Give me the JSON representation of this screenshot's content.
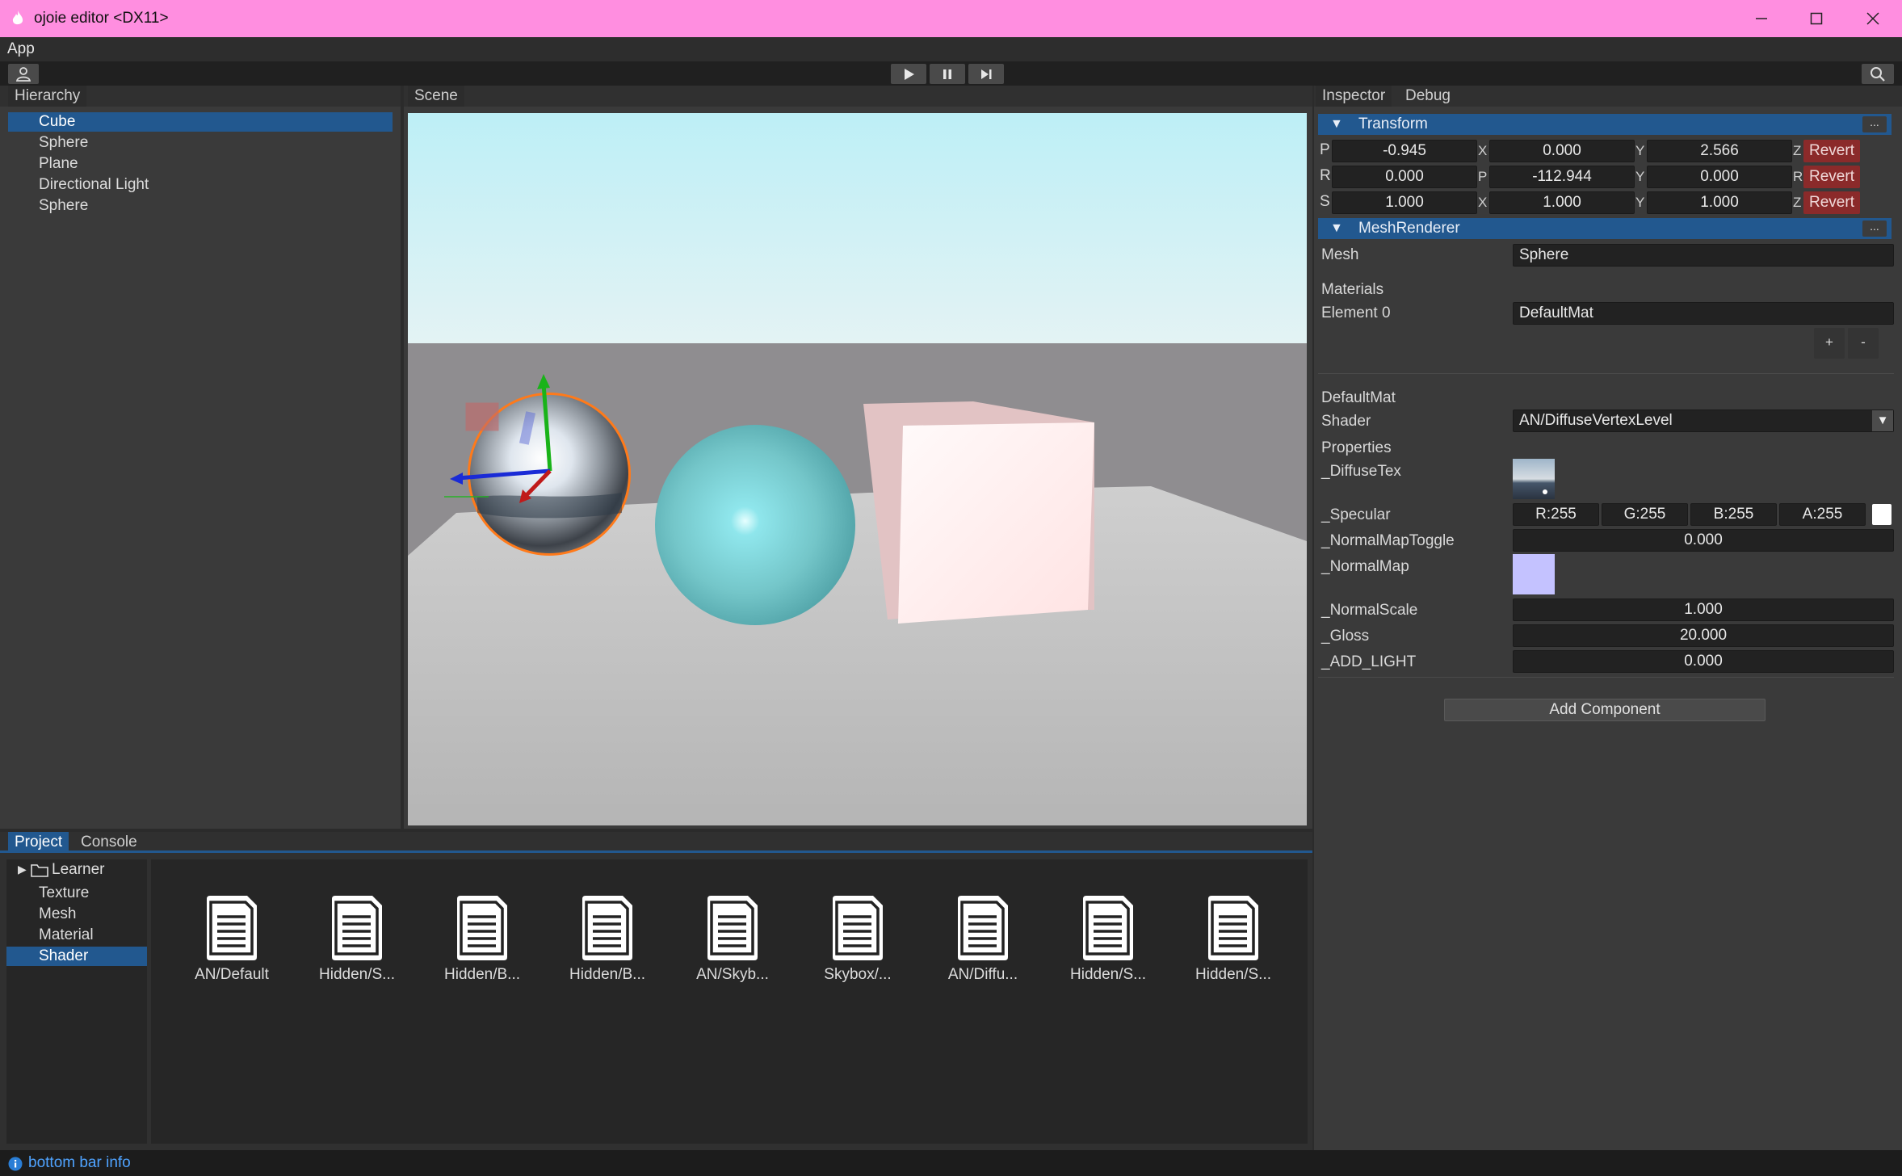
{
  "window": {
    "title": "ojoie editor <DX11>",
    "title_bar_color": "#ff8ee0",
    "accent_color": "#22588f",
    "revert_color": "#8b2a2a"
  },
  "menu": {
    "items": [
      "App"
    ]
  },
  "toolbar": {
    "user_icon": "user-icon",
    "play_icon": "play-icon",
    "pause_icon": "pause-icon",
    "step_icon": "step-icon",
    "search_icon": "search-icon"
  },
  "hierarchy": {
    "tab_label": "Hierarchy",
    "items": [
      "Cube",
      "Sphere",
      "Plane",
      "Directional Light",
      "Sphere"
    ],
    "selected_index": 0
  },
  "scene": {
    "tab_label": "Scene"
  },
  "inspector": {
    "tabs": [
      "Inspector",
      "Debug"
    ],
    "transform": {
      "header": "Transform",
      "more_label": "...",
      "rows": [
        {
          "label": "P",
          "v1": "-0.945",
          "a1": "X",
          "v2": "0.000",
          "a2": "Y",
          "v3": "2.566",
          "a3": "Z",
          "revert": "Revert"
        },
        {
          "label": "R",
          "v1": "0.000",
          "a1": "P",
          "v2": "-112.944",
          "a2": "Y",
          "v3": "0.000",
          "a3": "R",
          "revert": "Revert"
        },
        {
          "label": "S",
          "v1": "1.000",
          "a1": "X",
          "v2": "1.000",
          "a2": "Y",
          "v3": "1.000",
          "a3": "Z",
          "revert": "Revert"
        }
      ]
    },
    "mesh_renderer": {
      "header": "MeshRenderer",
      "more_label": "...",
      "mesh_label": "Mesh",
      "mesh_value": "Sphere",
      "materials_label": "Materials",
      "element0_label": "Element 0",
      "element0_value": "DefaultMat",
      "add_label": "+",
      "remove_label": "-"
    },
    "material": {
      "name": "DefaultMat",
      "shader_label": "Shader",
      "shader_value": "AN/DiffuseVertexLevel",
      "properties_label": "Properties",
      "diffuse_tex_label": "_DiffuseTex",
      "specular_label": "_Specular",
      "specular_r": "R:255",
      "specular_g": "G:255",
      "specular_b": "B:255",
      "specular_a": "A:255",
      "normal_map_toggle_label": "_NormalMapToggle",
      "normal_map_toggle_value": "0.000",
      "normal_map_label": "_NormalMap",
      "normal_map_swatch_color": "#c4c2ff",
      "normal_scale_label": "_NormalScale",
      "normal_scale_value": "1.000",
      "gloss_label": "_Gloss",
      "gloss_value": "20.000",
      "add_light_label": "_ADD_LIGHT",
      "add_light_value": "0.000"
    },
    "add_component_label": "Add Component"
  },
  "project": {
    "tabs": [
      "Project",
      "Console"
    ],
    "tree_root": "Learner",
    "folders": [
      "Texture",
      "Mesh",
      "Material",
      "Shader"
    ],
    "selected_folder_index": 3,
    "assets": [
      "AN/Default",
      "Hidden/S...",
      "Hidden/B...",
      "Hidden/B...",
      "AN/Skyb...",
      "Skybox/...",
      "AN/Diffu...",
      "Hidden/S...",
      "Hidden/S..."
    ]
  },
  "status": {
    "icon": "info-icon",
    "text": "bottom bar info"
  }
}
